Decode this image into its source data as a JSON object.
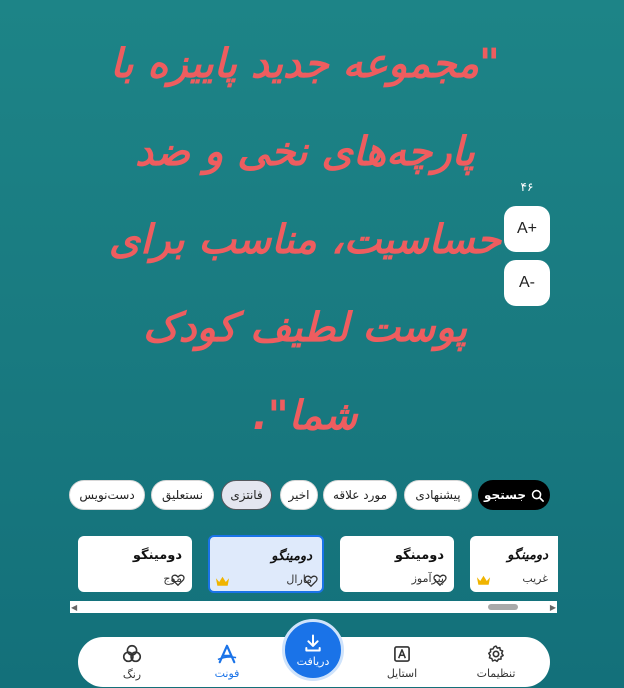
{
  "preview": {
    "text": "\"مجموعه جدید پاییزه با پارچه‌های نخی و ضد حساسیت، مناسب برای پوست لطیف کودک شما\"."
  },
  "font_size": {
    "value": "۴۶",
    "increase_label": "A+",
    "decrease_label": "A-"
  },
  "categories": {
    "search": "جستجو",
    "items": [
      "پیشنهادی",
      "مورد علاقه",
      "اخیر",
      "فانتزی",
      "نستعلیق",
      "دست‌نویس"
    ],
    "selected": "فانتزی"
  },
  "fonts": [
    {
      "name": "دومینگو",
      "sub": "غریب",
      "premium": true,
      "selected": false
    },
    {
      "name": "دومینگو",
      "sub": "پیرآموز",
      "premium": false,
      "selected": false
    },
    {
      "name": "دومینگو",
      "sub": "مارال",
      "premium": true,
      "selected": true
    },
    {
      "name": "دومینگو",
      "sub": "موج",
      "premium": false,
      "selected": false
    }
  ],
  "nav": {
    "settings": "تنظیمات",
    "style": "استایل",
    "download": "دریافت",
    "font": "فونت",
    "color": "رنگ",
    "active": "font"
  },
  "colors": {
    "background": "#197a80",
    "preview_text": "#ee5d5f",
    "accent": "#1a73e8",
    "crown": "#f0b400"
  },
  "icons": {
    "search": "search-icon",
    "heart": "heart-icon",
    "crown": "crown-icon",
    "settings": "gear-icon",
    "style": "style-icon",
    "download": "download-icon",
    "font": "font-icon",
    "color": "palette-icon"
  }
}
